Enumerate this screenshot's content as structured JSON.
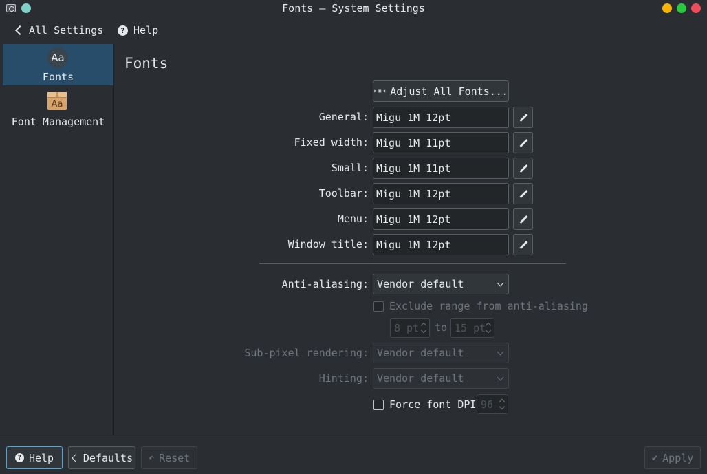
{
  "window": {
    "title": "Fonts — System Settings",
    "controls": {
      "minimize_color": "#f6b400",
      "maximize_color": "#27c93f",
      "close_color": "#ee4c5b",
      "pin_color": "#7fd1c8"
    }
  },
  "toolbar": {
    "back_label": "All Settings",
    "help_label": "Help",
    "help_icon_text": "?"
  },
  "sidebar": {
    "items": [
      {
        "label": "Fonts",
        "icon": "fonts-icon",
        "icon_text": "Aa",
        "active": true
      },
      {
        "label": "Font Management",
        "icon": "font-package-icon",
        "icon_text": "Aa",
        "active": false
      }
    ]
  },
  "main": {
    "title": "Fonts",
    "adjust_all_label": "Adjust All Fonts...",
    "fonts": [
      {
        "label": "General:",
        "value": "Migu 1M 12pt"
      },
      {
        "label": "Fixed width:",
        "value": "Migu 1M 11pt"
      },
      {
        "label": "Small:",
        "value": "Migu 1M 11pt"
      },
      {
        "label": "Toolbar:",
        "value": "Migu 1M 12pt"
      },
      {
        "label": "Menu:",
        "value": "Migu 1M 12pt"
      },
      {
        "label": "Window title:",
        "value": "Migu 1M 12pt"
      }
    ],
    "antialiasing": {
      "label": "Anti-aliasing:",
      "value": "Vendor default"
    },
    "exclude_range": {
      "label": "Exclude range from anti-aliasing",
      "checked": false,
      "from": "8 pt",
      "to_label": "to",
      "to": "15 pt"
    },
    "subpixel": {
      "label": "Sub-pixel rendering:",
      "value": "Vendor default"
    },
    "hinting": {
      "label": "Hinting:",
      "value": "Vendor default"
    },
    "force_dpi": {
      "label": "Force font DPI:",
      "checked": false,
      "value": "96"
    }
  },
  "bottom": {
    "help_label": "Help",
    "help_icon_text": "?",
    "defaults_label": "Defaults",
    "reset_label": "Reset",
    "reset_icon": "↶",
    "apply_label": "Apply",
    "apply_icon": "✔"
  },
  "accent_color": "#3daee9"
}
